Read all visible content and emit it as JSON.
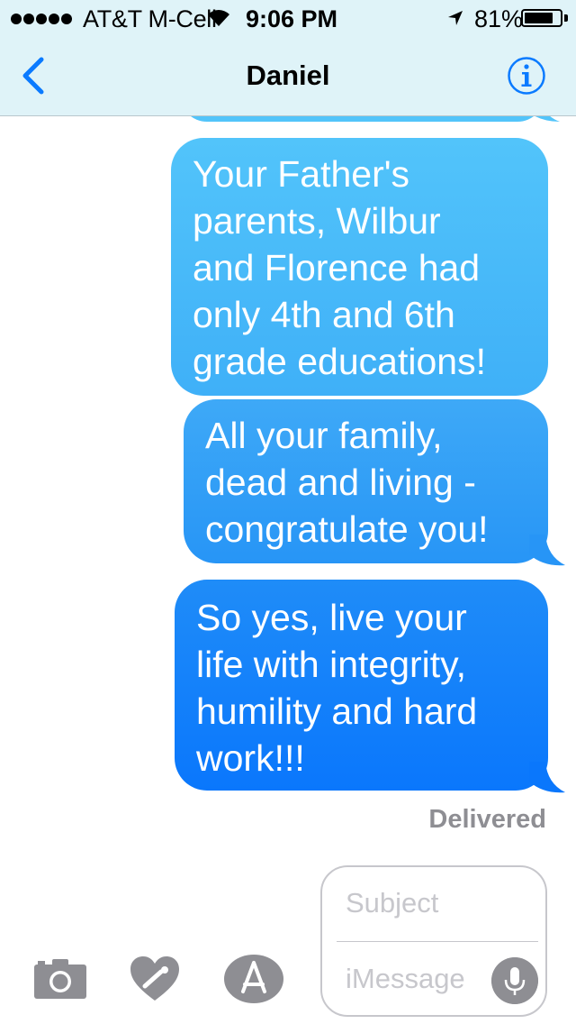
{
  "status_bar": {
    "carrier": "AT&T M-Cell",
    "time": "9:06 PM",
    "battery_percent": "81%",
    "battery_level": 0.81,
    "signal_dots": 5
  },
  "nav": {
    "back_icon": "chevron-left-icon",
    "title": "Daniel",
    "info_icon": "info-icon"
  },
  "colors": {
    "accent": "#0a7aff",
    "bubble_top": "#52c4fa",
    "bubble_bottom": "#0a77fc",
    "header_bg": "#dff3f8",
    "placeholder": "#c7c7cc",
    "meta_text": "#8e8e93"
  },
  "messages": [
    {
      "lines": [
        "Your Father's",
        "parents, Wilbur",
        "and Florence had",
        "only 4th and 6th",
        "grade educations!"
      ],
      "direction": "sent"
    },
    {
      "lines": [
        "All your family,",
        "dead and living -",
        "congratulate you!"
      ],
      "direction": "sent"
    },
    {
      "lines": [
        "So yes, live your",
        "life with integrity,",
        "humility and hard",
        "work!!!"
      ],
      "direction": "sent"
    }
  ],
  "delivery_status": "Delivered",
  "composer": {
    "subject_placeholder": "Subject",
    "message_placeholder": "iMessage",
    "tools": [
      "camera-icon",
      "digital-touch-icon",
      "app-store-icon"
    ],
    "mic_icon": "microphone-icon"
  }
}
